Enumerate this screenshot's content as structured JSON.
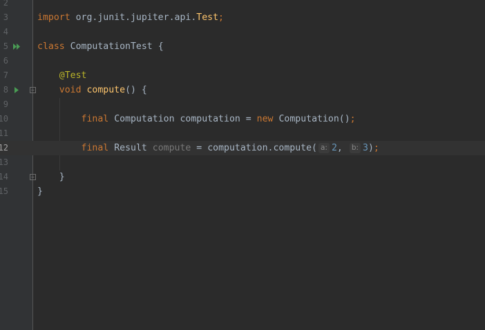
{
  "editor": {
    "lines": [
      {
        "num": "2"
      },
      {
        "num": "3",
        "import_kw": "import",
        "import_pkg": "org.junit.jupiter.api.",
        "import_cls": "Test",
        "semi": ";"
      },
      {
        "num": "4"
      },
      {
        "num": "5",
        "class_kw": "class",
        "class_name": "ComputationTest",
        "brace": " {",
        "gutter": "run-all-tests-icon"
      },
      {
        "num": "6"
      },
      {
        "num": "7",
        "annotation": "@Test"
      },
      {
        "num": "8",
        "void_kw": "void",
        "method_name": "compute",
        "sig_rest": "() {",
        "gutter": "run-test-icon"
      },
      {
        "num": "9"
      },
      {
        "num": "10",
        "final_kw": "final",
        "type": "Computation",
        "var": "computation",
        "eq": " = ",
        "new_kw": "new",
        "ctor": "Computation()",
        "semi": ";"
      },
      {
        "num": "11"
      },
      {
        "num": "12",
        "final_kw": "final",
        "type": "Result",
        "var_unused": "compute",
        "eq": " = ",
        "call": "computation.compute(",
        "hint_a": "a:",
        "arg_a": "2",
        "comma": ", ",
        "hint_b": "b:",
        "arg_b": "3",
        "close": ")",
        "semi": ";"
      },
      {
        "num": "13"
      },
      {
        "num": "14",
        "brace": "}"
      },
      {
        "num": "15",
        "brace": "}"
      }
    ]
  }
}
